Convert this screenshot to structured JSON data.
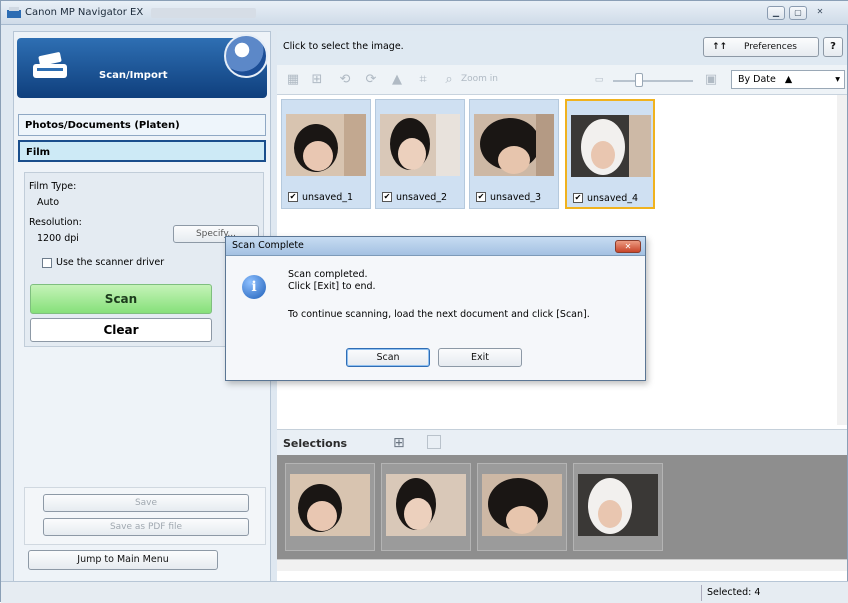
{
  "window": {
    "title": "Canon MP Navigator EX"
  },
  "left": {
    "header_label": "Scan/Import",
    "sources": [
      "Photos/Documents (Platen)",
      "Film"
    ],
    "film_type_label": "Film Type:",
    "film_type_value": "Auto",
    "resolution_label": "Resolution:",
    "resolution_value": "1200 dpi",
    "specify_label": "Specify...",
    "use_driver_label": "Use the scanner driver",
    "scan_label": "Scan",
    "clear_label": "Clear",
    "save_label": "Save",
    "save_pdf_label": "Save as PDF file",
    "jump_label": "Jump to Main Menu"
  },
  "right": {
    "hint": "Click to select the image.",
    "preferences_label": "Preferences",
    "help_label": "?",
    "zoom_label": "Zoom in",
    "sort_value": "By Date",
    "thumbnails": [
      {
        "label": "unsaved_1",
        "checked": true
      },
      {
        "label": "unsaved_2",
        "checked": true
      },
      {
        "label": "unsaved_3",
        "checked": true
      },
      {
        "label": "unsaved_4",
        "checked": true
      }
    ],
    "selections_label": "Selections",
    "status_selected": "Selected: 4"
  },
  "dialog": {
    "title": "Scan Complete",
    "line1": "Scan completed.",
    "line2": "Click [Exit] to end.",
    "line3": "To continue scanning, load the next document and click [Scan].",
    "scan_button": "Scan",
    "exit_button": "Exit"
  }
}
